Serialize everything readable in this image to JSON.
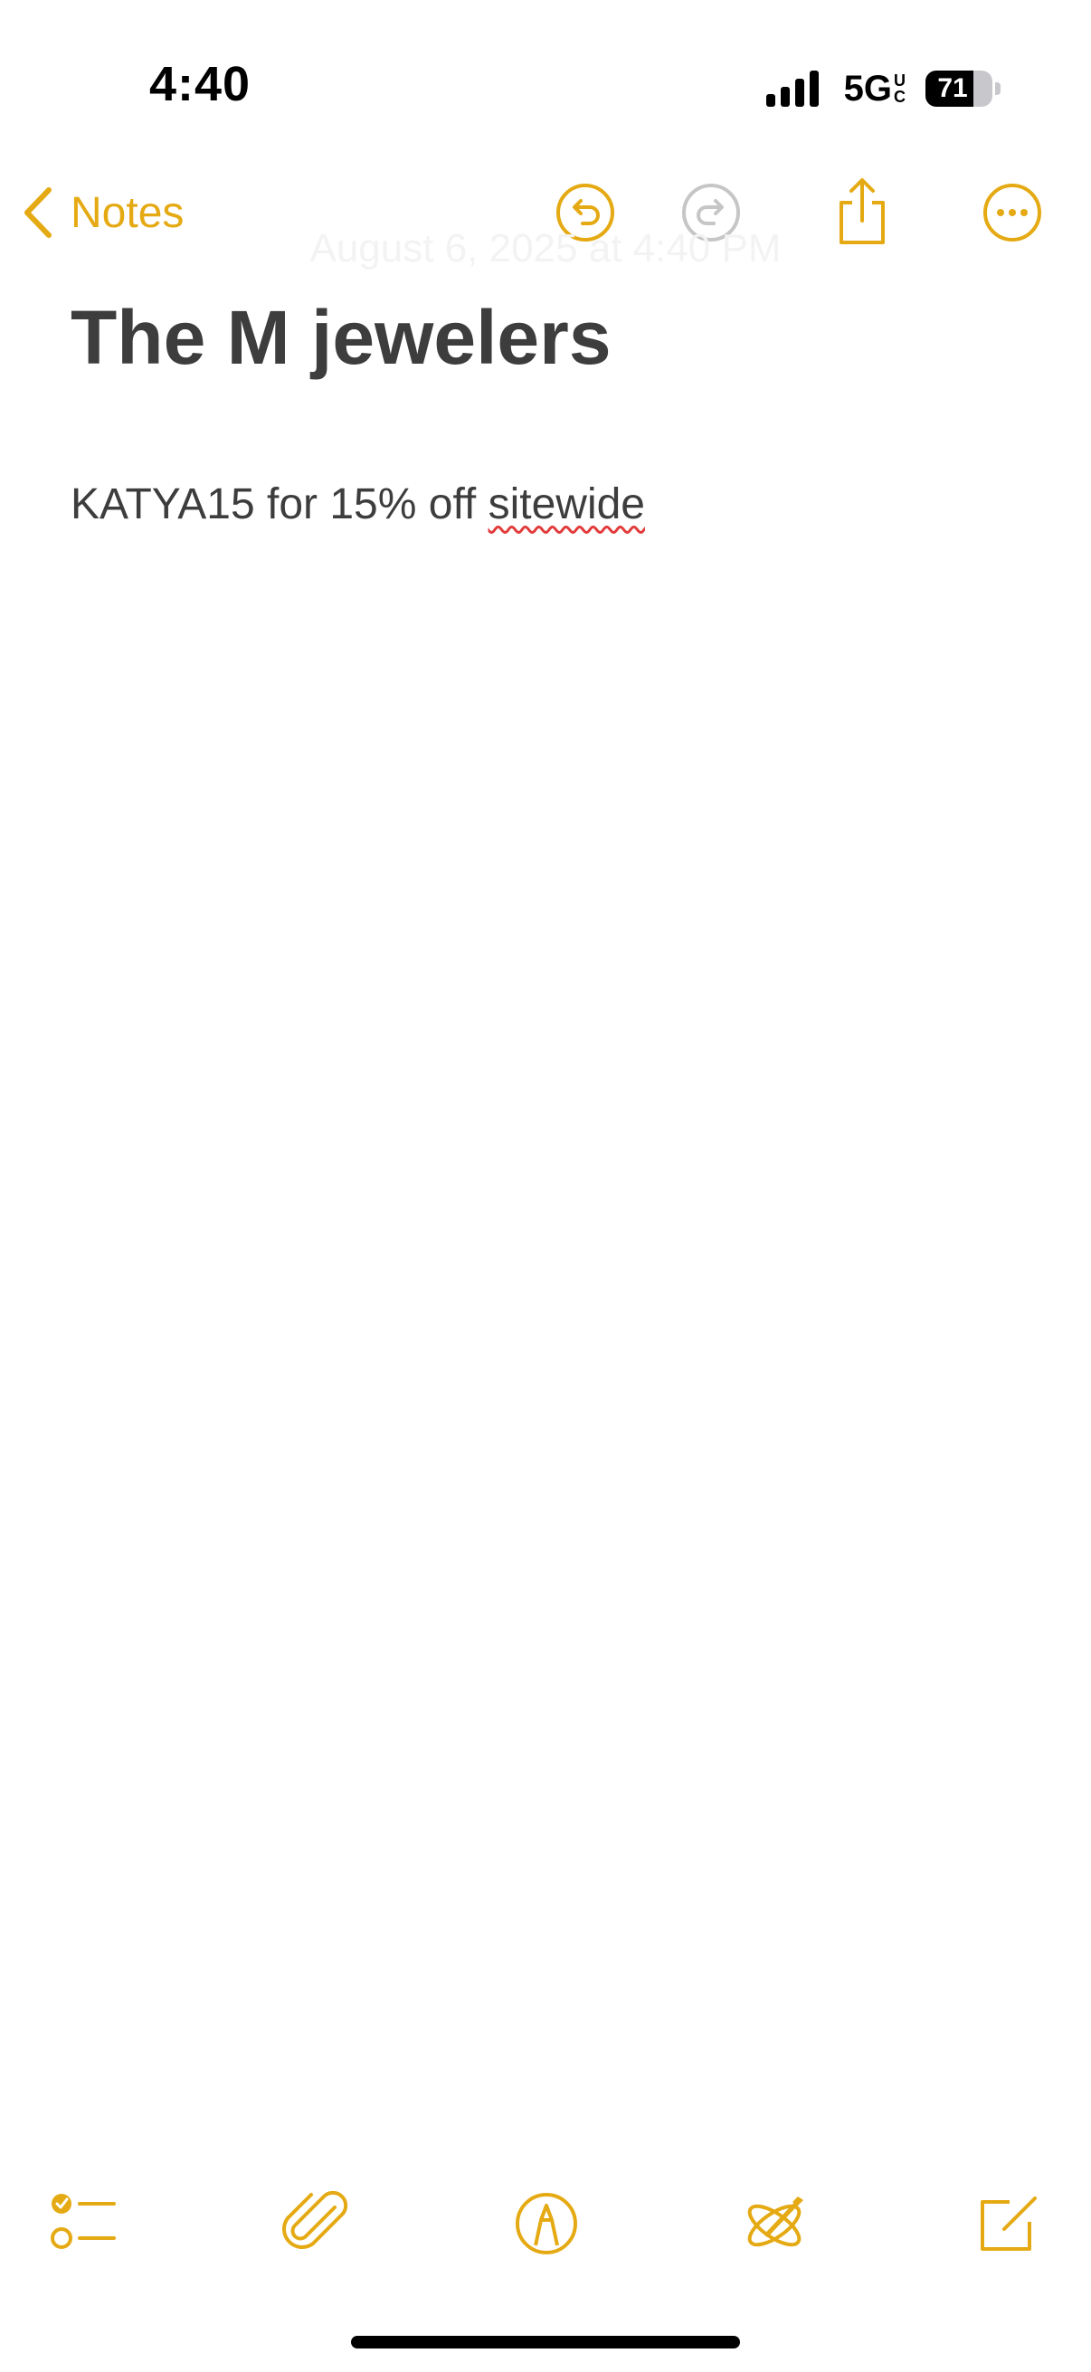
{
  "status_bar": {
    "time": "4:40",
    "network": "5G",
    "network_suffix_top": "U",
    "network_suffix_bottom": "C",
    "battery_level": "71",
    "battery_fraction": 0.71
  },
  "nav": {
    "back_label": "Notes",
    "icons": [
      "chevron-left-icon",
      "undo-icon",
      "redo-icon",
      "share-icon",
      "more-icon"
    ]
  },
  "note": {
    "date": "August 6, 2025 at 4:40 PM",
    "title": "The M jewelers",
    "body_prefix": "KATYA15 for 15% off ",
    "body_misspelled": "sitewide"
  },
  "toolbar": {
    "icons": [
      "checklist-icon",
      "attachment-icon",
      "markup-icon",
      "writing-tools-icon",
      "compose-icon"
    ]
  },
  "colors": {
    "accent": "#e5aa13",
    "disabled": "#c6c6c6",
    "text": "#3d3d3d",
    "spellcheck": "#e23b3b"
  }
}
